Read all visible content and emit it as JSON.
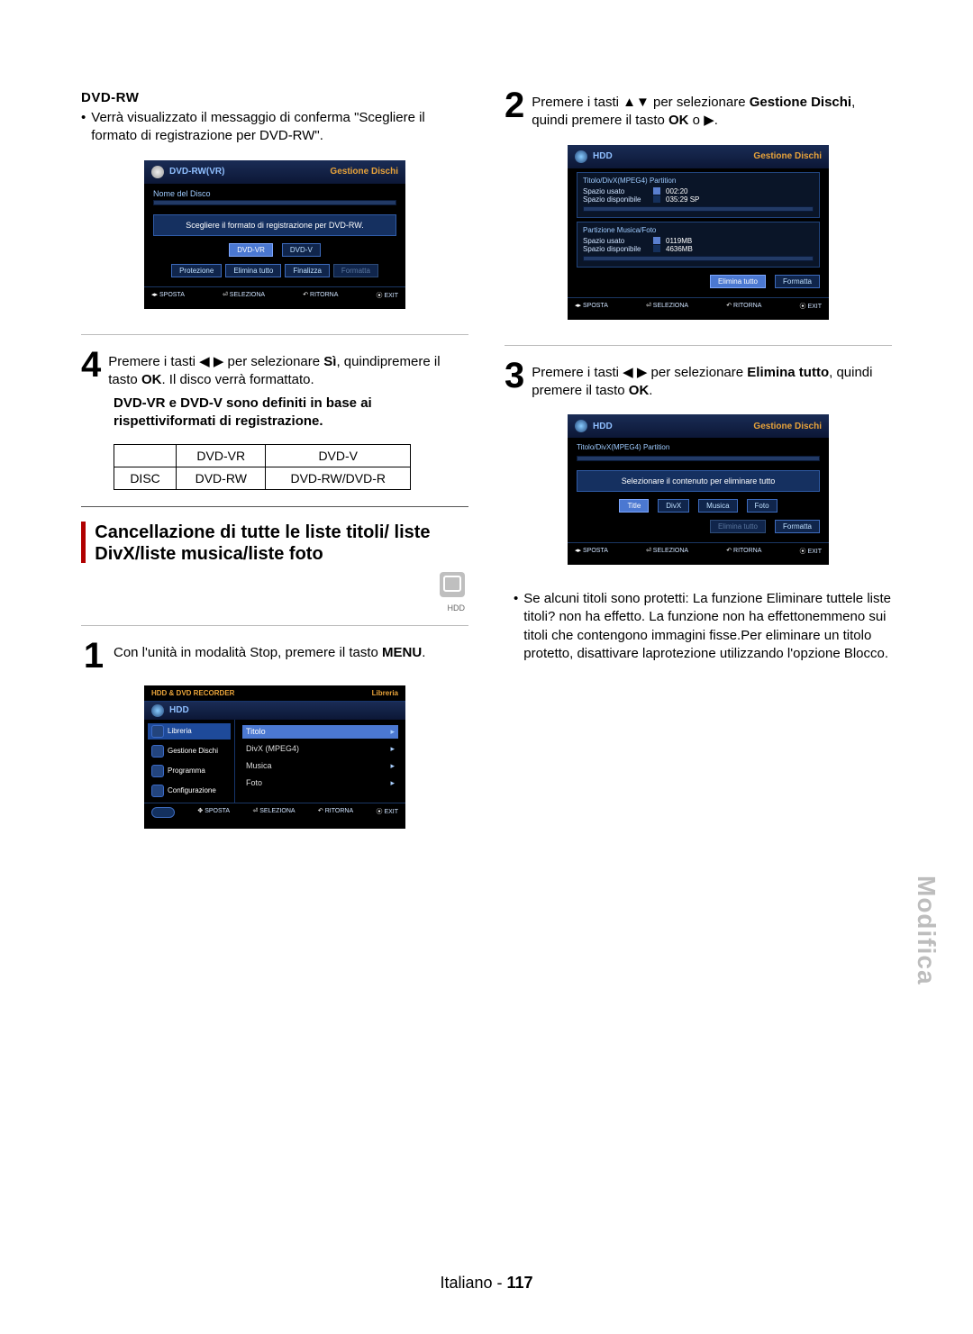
{
  "left": {
    "dvdrw_heading": "DVD-RW",
    "dvdrw_bullet": "Verrà visualizzato il messaggio di conferma \"Scegliere il formato di registrazione per DVD-RW\".",
    "osd1": {
      "title": "DVD-RW(VR)",
      "top_right": "Gestione Dischi",
      "name_label": "Nome del Disco",
      "message": "Scegliere il formato di registrazione per DVD-RW.",
      "btn_vr": "DVD-VR",
      "btn_v": "DVD-V",
      "bottom_btn1": "Protezione",
      "bottom_btn2": "Elimina tutto",
      "bottom_btn3": "Finalizza",
      "bottom_btn4": "Formatta",
      "foot_move": "SPOSTA",
      "foot_sel": "SELEZIONA",
      "foot_ret": "RITORNA",
      "foot_exit": "EXIT"
    },
    "step4a": "Premere i tasti ",
    "step4b": " per selezionare ",
    "step4_si": "Sì",
    "step4c": ", quindipremere il tasto ",
    "step4_ok": "OK",
    "step4d": ". Il disco verrà formattato.",
    "formats_note": "DVD-VR e DVD-V sono definiti in base ai rispettiviformati di registrazione.",
    "table": {
      "h1": "DVD-VR",
      "h2": "DVD-V",
      "r1c0": "DISC",
      "r1c1": "DVD-RW",
      "r1c2": "DVD-RW/DVD-R"
    },
    "section_title": "Cancellazione di tutte le liste titoli/ liste DivX/liste musica/liste foto",
    "hdd_label": "HDD",
    "step1a": "Con l'unità in modalità Stop, premere il tasto ",
    "step1_menu": "MENU",
    "step1b": ".",
    "osd2": {
      "topbar": "HDD & DVD RECORDER",
      "top_right": "Libreria",
      "device": "HDD",
      "m_lib": "Libreria",
      "m_disc": "Gestione Dischi",
      "m_prog": "Programma",
      "m_conf": "Configurazione",
      "r_title": "Titolo",
      "r_divx": "DivX (MPEG4)",
      "r_music": "Musica",
      "r_photo": "Foto",
      "foot_move": "SPOSTA",
      "foot_sel": "SELEZIONA",
      "foot_ret": "RITORNA",
      "foot_exit": "EXIT"
    }
  },
  "right": {
    "step2a": "Premere i tasti ",
    "step2b": " per selezionare ",
    "step2_bold": "Gestione Dischi",
    "step2c": ", quindi premere il tasto ",
    "step2_ok": "OK",
    "step2d": " o ",
    "step2e": ".",
    "osd3": {
      "device": "HDD",
      "top_right": "Gestione Dischi",
      "part1_title": "Titolo/DivX(MPEG4) Partition",
      "p1_used_label": "Spazio usato",
      "p1_used_val": "002:20",
      "p1_free_label": "Spazio disponibile",
      "p1_free_val": "035:29  SP",
      "part2_title": "Partizione Musica/Foto",
      "p2_used_label": "Spazio usato",
      "p2_used_val": "0119MB",
      "p2_free_label": "Spazio disponibile",
      "p2_free_val": "4636MB",
      "btn_erase": "Elimina tutto",
      "btn_format": "Formatta",
      "foot_move": "SPOSTA",
      "foot_sel": "SELEZIONA",
      "foot_ret": "RITORNA",
      "foot_exit": "EXIT"
    },
    "step3a": "Premere i tasti ",
    "step3b": " per selezionare ",
    "step3_bold": "Elimina tutto",
    "step3c": ", quindi premere il tasto ",
    "step3_ok": "OK",
    "step3d": ".",
    "osd4": {
      "device": "HDD",
      "top_right": "Gestione Dischi",
      "part1_title": "Titolo/DivX(MPEG4) Partition",
      "message": "Selezionare il contenuto per eliminare tutto",
      "btn_title": "Title",
      "btn_divx": "DivX",
      "btn_music": "Musica",
      "btn_photo": "Foto",
      "btn_erase": "Elimina tutto",
      "btn_format": "Formatta",
      "foot_move": "SPOSTA",
      "foot_sel": "SELEZIONA",
      "foot_ret": "RITORNA",
      "foot_exit": "EXIT"
    },
    "note_bullet": "Se alcuni titoli sono protetti: La funzione Eliminare tuttele liste titoli? non ha effetto. La funzione non ha effettonemmeno sui titoli che contengono immagini fisse.Per eliminare un titolo protetto, disattivare laprotezione utilizzando l'opzione Blocco."
  },
  "side_tab": "Modifica",
  "footer_lang": "Italiano - ",
  "footer_page": "117"
}
